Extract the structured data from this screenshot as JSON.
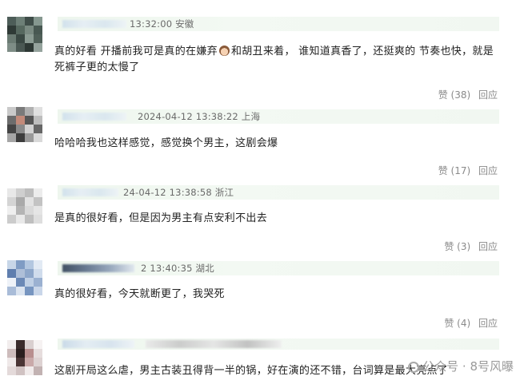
{
  "comments": [
    {
      "meta": "13:32:00 安徽",
      "text": "真的好看 开播前我可是真的在嫌弃",
      "text2": "和胡丑来着， 谁知道真香了，还挺爽的 节奏也快，就是死裤子更的太慢了",
      "likes": "赞 (38)",
      "reply": "回应"
    },
    {
      "meta": "2024-04-12 13:38:22 上海",
      "text": "哈哈哈我也这样感觉，感觉换个男主，这剧会爆",
      "likes": "赞 (17)",
      "reply": "回应"
    },
    {
      "meta": "24-04-12 13:38:58 浙江",
      "text": "是真的很好看，但是因为男主有点安利不出去",
      "likes": "赞 (3)",
      "reply": "回应"
    },
    {
      "meta": "2 13:40:35 湖北",
      "text": "真的很好看，今天就断更了，我哭死",
      "likes": "赞 (4)",
      "reply": "回应"
    },
    {
      "meta": "",
      "text": "这剧开局这么虐，男主古装丑得背一半的锅，好在演的还不错，台词算是最大亮点了",
      "likes": "",
      "reply": ""
    }
  ],
  "watermark": "公众号 · 8号风曝",
  "icons": {
    "watermark": "wechat-icon",
    "emoji": "girl-face-emoji"
  }
}
